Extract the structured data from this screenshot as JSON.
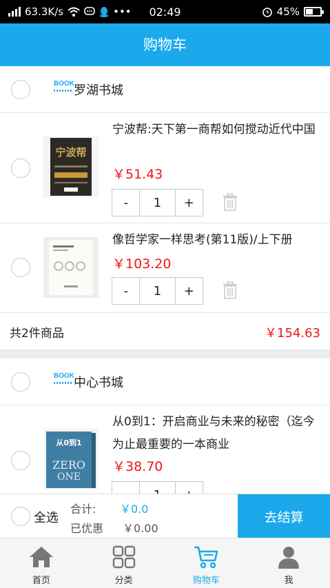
{
  "status_bar": {
    "speed": "63.3K/s",
    "time": "02:49",
    "battery": "45%",
    "battery_level": 0.45
  },
  "header": {
    "title": "购物车"
  },
  "stores": [
    {
      "name": "罗湖书城",
      "items": [
        {
          "title": "宁波帮:天下第一商帮如何搅动近代中国",
          "price": "￥51.43",
          "qty": "1"
        },
        {
          "title": "像哲学家一样思考(第11版)/上下册",
          "price": "￥103.20",
          "qty": "1"
        }
      ],
      "summary": {
        "count_text": "共2件商品",
        "total": "￥154.63"
      }
    },
    {
      "name": "中心书城",
      "items": [
        {
          "title": "从0到1：开启商业与未来的秘密（迄今为止最重要的一本商业",
          "price": "￥38.70",
          "qty": "1"
        }
      ]
    }
  ],
  "store_logo_text": "BOOK",
  "stepper": {
    "minus": "-",
    "plus": "+"
  },
  "book_covers": {
    "book1": "宁波帮",
    "book3_top": "从0到1",
    "book3_a": "ZERO",
    "book3_b": "ONE"
  },
  "checkout": {
    "select_all": "全选",
    "sum_label": "合计:",
    "sum_value": "￥0.0",
    "discount_label": "已优惠",
    "discount_value": "￥0.00",
    "pay_button": "去结算"
  },
  "tabs": [
    {
      "label": "首页",
      "icon": "home-icon"
    },
    {
      "label": "分类",
      "icon": "category-icon"
    },
    {
      "label": "购物车",
      "icon": "cart-icon",
      "active": true
    },
    {
      "label": "我",
      "icon": "user-icon"
    }
  ],
  "colors": {
    "accent": "#1ba9ec",
    "price": "#f01414"
  }
}
